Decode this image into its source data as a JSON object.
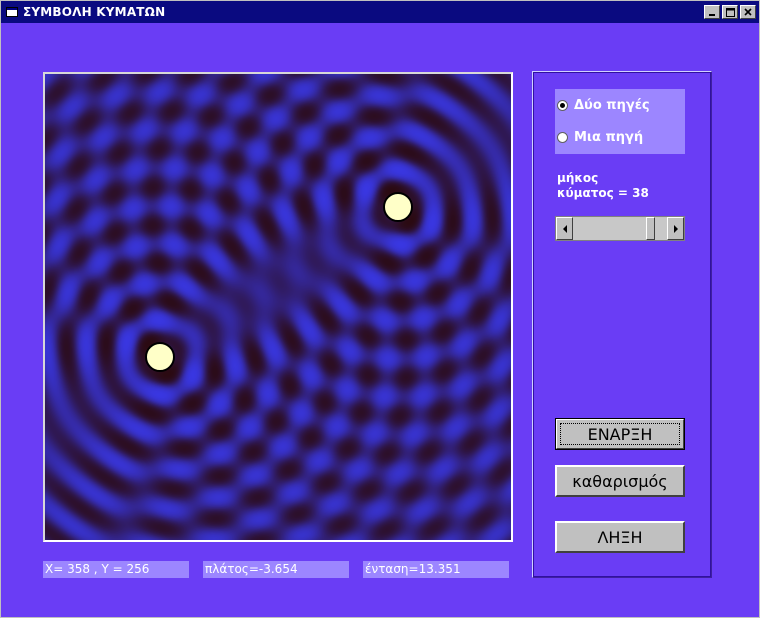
{
  "window": {
    "title": "ΣΥΜΒΟΛΗ ΚΥΜΑΤΩΝ",
    "controls": [
      "minimize",
      "maximize",
      "close"
    ]
  },
  "colors": {
    "background": "#6a3df5",
    "wave_bright": "#3a3af0",
    "wave_dark": "#2a0808",
    "source_fill": "#ffffc8",
    "titlebar": "#0a0a80",
    "panel_highlight": "#9c86ff"
  },
  "options": {
    "sources": [
      {
        "label": "Δύο πηγές",
        "selected": true
      },
      {
        "label": "Μια πηγή",
        "selected": false
      }
    ]
  },
  "wavelength": {
    "label_line1": "μήκος",
    "label_line2": "κύματος = 38",
    "value": 38,
    "slider_fraction": 0.86
  },
  "buttons": {
    "start": "ΕΝΑΡΞΗ",
    "clear": "καθαρισμός",
    "end": "ΛΗΞΗ"
  },
  "status": {
    "coords": "X= 358 , Y =  256",
    "amplitude": "πλάτος=-3.654",
    "intensity": "ένταση=13.351"
  }
}
